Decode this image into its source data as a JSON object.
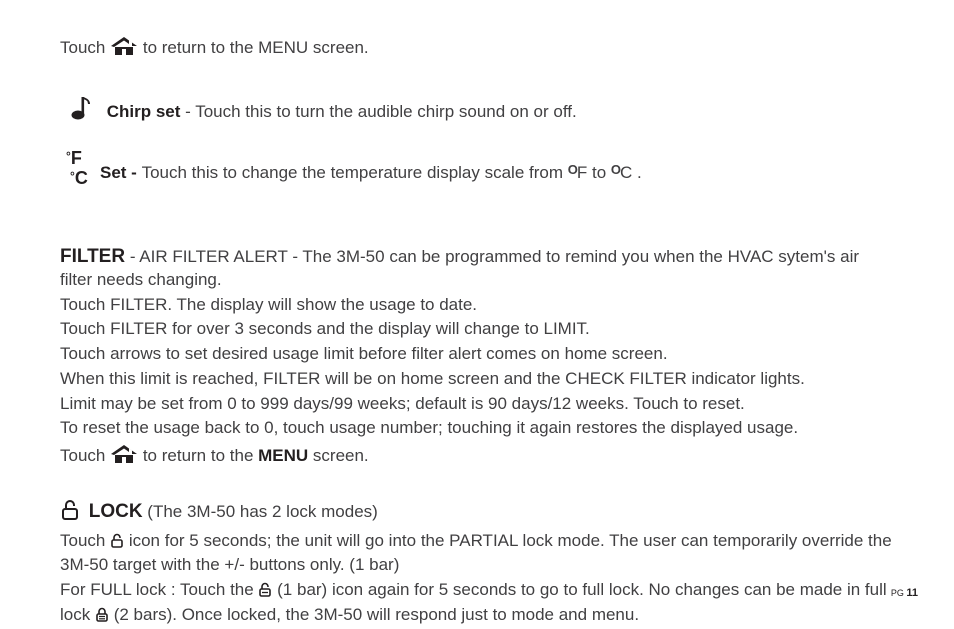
{
  "line1_a": "Touch",
  "line1_b": " to return to the MENU screen.",
  "chirp_title": "Chirp set",
  "chirp_body": " - Touch this to turn the audible chirp sound on or off.",
  "fc_top": "F",
  "fc_bottom": "C",
  "set_title": "Set - ",
  "set_body_a": "Touch this to change the temperature display scale from  ",
  "set_body_b": "F to ",
  "set_body_c": "C .",
  "filter_title": "FILTER",
  "filter_1": " - AIR FILTER ALERT - The  3M-50 can be programmed to remind you when the HVAC sytem's air filter needs changing.",
  "filter_2": "Touch FILTER. The display will show the usage to date.",
  "filter_3": "Touch FILTER for over 3 seconds and the display will change to LIMIT.",
  "filter_4": "Touch arrows to set desired usage limit before filter alert comes on home screen.",
  "filter_5": "When this limit is reached, FILTER will be on home screen and the CHECK FILTER indicator lights.",
  "filter_6": "Limit may be set from 0 to 999 days/99 weeks; default is 90 days/12 weeks. Touch to reset.",
  "filter_7": "To reset the usage back to 0, touch usage number; touching it again restores the displayed usage.",
  "filter_8a": "Touch ",
  "filter_8b": "  to return to the ",
  "filter_8c": "MENU",
  "filter_8d": " screen.",
  "lock_title": "LOCK",
  "lock_sub": "  (The 3M-50 has 2 lock modes)",
  "lock_1a": "Touch ",
  "lock_1b": " icon for 5 seconds; the unit will go into the PARTIAL lock mode. The user can temporarily override the 3M-50 target with the +/- buttons only. (1 bar)",
  "lock_2a": "For FULL lock : Touch the ",
  "lock_2b": " (1 bar) icon again for 5 seconds to go to full lock. No changes can be made in full lock ",
  "lock_2c": " (2 bars).  Once locked, the 3M-50 will respond just to mode and menu.",
  "footer_pg": "PG ",
  "footer_num": "11"
}
